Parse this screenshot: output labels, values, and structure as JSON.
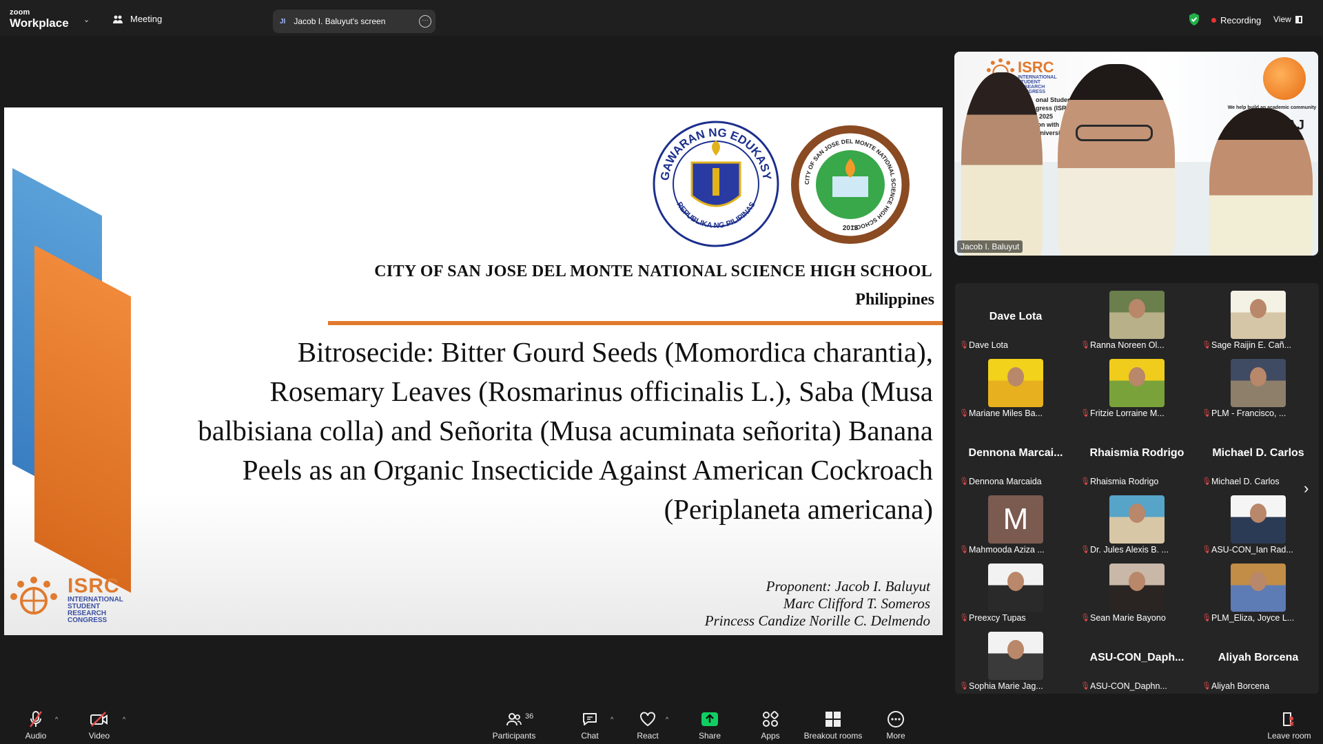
{
  "app": {
    "brand_small": "zoom",
    "brand_big": "Workplace",
    "meeting_label": "Meeting"
  },
  "screen_share": {
    "initials": "JI",
    "label": "Jacob I. Baluyut's screen"
  },
  "status": {
    "recording_label": "Recording",
    "view_label": "View"
  },
  "slide": {
    "school": "CITY OF SAN JOSE DEL MONTE NATIONAL SCIENCE HIGH SCHOOL",
    "country": "Philippines",
    "title_lines": [
      "Bitrosecide: Bitter Gourd Seeds (Momordica charantia),",
      "Rosemary Leaves (Rosmarinus officinalis L.), Saba (Musa",
      "balbisiana colla) and Señorita (Musa acuminata señorita) Banana",
      "Peels as an Organic Insecticide Against American Cockroach",
      "(Periplaneta americana)"
    ],
    "proponents": [
      "Proponent: Jacob I. Baluyut",
      "Marc Clifford T. Someros",
      "Princess Candize Norille C. Delmendo"
    ],
    "isrc_logo": {
      "abbr": "ISRC",
      "lines": [
        "INTERNATIONAL",
        "STUDENT",
        "RESEARCH",
        "CONGRESS"
      ]
    },
    "seal1_text": {
      "top": "KAGAWARAN NG EDUKASYON",
      "bottom": "REPUBLIKA NG PILIPINAS"
    },
    "seal2_text": {
      "ring": "CITY OF SAN JOSE DEL MONTE NATIONAL SCIENCE HIGH SCHOOL",
      "year": "2013"
    }
  },
  "speaker": {
    "name": "Jacob I. Baluyut",
    "banner_abbr": "ISRC",
    "banner_sub": [
      "INTERNATIONAL",
      "STUDENT",
      "RESEARCH",
      "CONGRESS"
    ],
    "banner_text": [
      "onal Student",
      "gress (ISRC",
      ", 2025",
      "ion with",
      "University"
    ],
    "iraj_tagline": "We help build an academic community",
    "iraj_short": "AJ"
  },
  "gallery": [
    {
      "big_name": "Dave Lota",
      "label": "Dave Lota",
      "kind": "name"
    },
    {
      "label": "Ranna Noreen Ol...",
      "kind": "photo",
      "colors": [
        "#6a7f4c",
        "#b8b089"
      ]
    },
    {
      "label": "Sage Raijin E. Cañ...",
      "kind": "photo",
      "colors": [
        "#f4f1e5",
        "#d6c6a8"
      ]
    },
    {
      "label": "Mariane Miles Ba...",
      "kind": "photo",
      "colors": [
        "#f2d21a",
        "#e7b01f"
      ]
    },
    {
      "label": "Fritzie Lorraine M...",
      "kind": "photo",
      "colors": [
        "#f0cd1c",
        "#7aa23a"
      ]
    },
    {
      "label": "PLM - Francisco, ...",
      "kind": "photo",
      "colors": [
        "#3f4a63",
        "#8d7f6a"
      ]
    },
    {
      "big_name": "Dennona  Marcai...",
      "label": "Dennona Marcaida",
      "kind": "name"
    },
    {
      "big_name": "Rhaismia Rodrigo",
      "label": "Rhaismia Rodrigo",
      "kind": "name"
    },
    {
      "big_name": "Michael D. Carlos",
      "label": "Michael D. Carlos",
      "kind": "name"
    },
    {
      "label": "Mahmooda Aziza ...",
      "kind": "letter",
      "letter": "M"
    },
    {
      "label": "Dr. Jules Alexis B. ...",
      "kind": "photo",
      "colors": [
        "#57a4c9",
        "#d8c7a6"
      ]
    },
    {
      "label": "ASU-CON_Ian Rad...",
      "kind": "photo",
      "colors": [
        "#f5f5f5",
        "#2c3b55"
      ]
    },
    {
      "label": "Preexcy Tupas",
      "kind": "photo",
      "colors": [
        "#f2f2f2",
        "#2a2a2a"
      ]
    },
    {
      "label": "Sean Marie Bayono",
      "kind": "photo",
      "colors": [
        "#c9b8a8",
        "#2a2422"
      ]
    },
    {
      "label": "PLM_Eliza, Joyce L...",
      "kind": "photo",
      "colors": [
        "#c28d47",
        "#5d7bb4"
      ]
    },
    {
      "label": "Sophia Marie Jag...",
      "kind": "photo",
      "colors": [
        "#f2f2f2",
        "#3a3a3a"
      ]
    },
    {
      "big_name": "ASU-CON_Daph...",
      "label": "ASU-CON_Daphn...",
      "kind": "name"
    },
    {
      "big_name": "Aliyah Borcena",
      "label": "Aliyah Borcena",
      "kind": "name"
    }
  ],
  "toolbar": {
    "audio": "Audio",
    "video": "Video",
    "participants": "Participants",
    "participants_count": "36",
    "chat": "Chat",
    "react": "React",
    "share": "Share",
    "apps": "Apps",
    "breakout": "Breakout rooms",
    "more": "More",
    "leave": "Leave room"
  },
  "colors": {
    "accent_orange": "#e07a2e",
    "share_green": "#0fcf62",
    "muted_red": "#e34b4b"
  }
}
